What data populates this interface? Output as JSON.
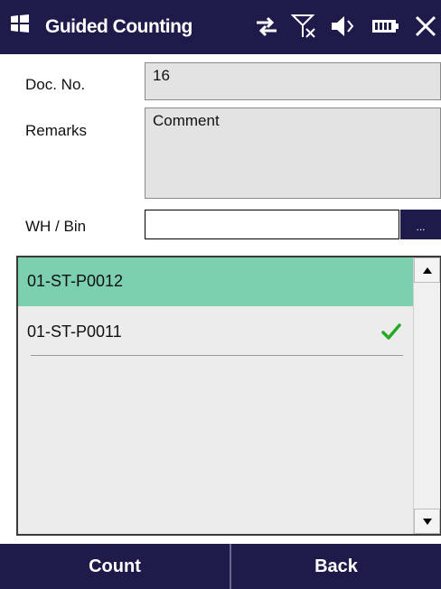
{
  "titlebar": {
    "title": "Guided Counting",
    "icons": [
      "windows-logo-icon",
      "sync-arrows-icon",
      "no-signal-icon",
      "speaker-icon",
      "battery-icon",
      "close-icon"
    ]
  },
  "form": {
    "doc_no_label": "Doc. No.",
    "doc_no_value": "16",
    "remarks_label": "Remarks",
    "remarks_value": "Comment",
    "wh_bin_label": "WH / Bin",
    "wh_bin_value": "",
    "browse_label": "..."
  },
  "list": {
    "items": [
      {
        "label": "01-ST-P0012",
        "selected": true,
        "checked": false
      },
      {
        "label": "01-ST-P0011",
        "selected": false,
        "checked": true
      }
    ]
  },
  "bottom": {
    "count_label": "Count",
    "back_label": "Back"
  },
  "colors": {
    "bar": "#1e1a4a",
    "selected_row": "#7ccfaf",
    "check": "#22aa22"
  }
}
